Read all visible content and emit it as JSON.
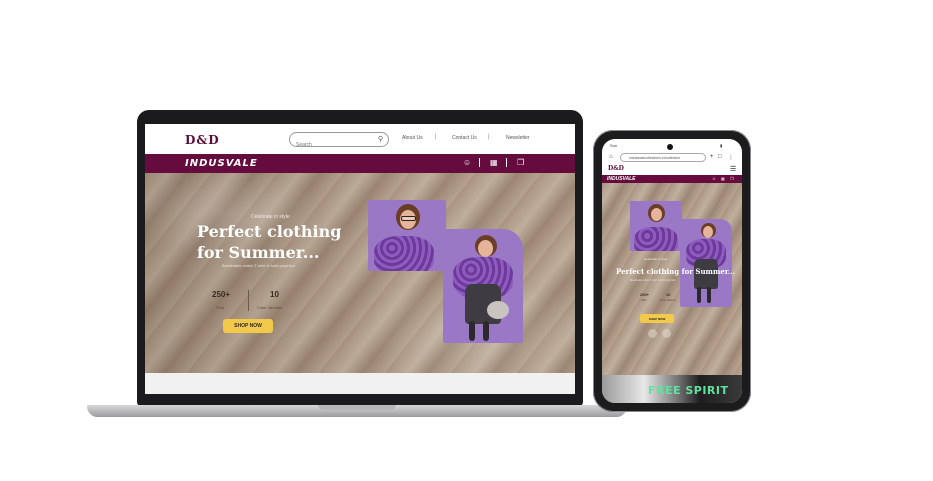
{
  "laptop": {
    "brand_logo": "D&D",
    "search_placeholder": "Search",
    "nav": {
      "about": "About Us",
      "contact": "Contact Us",
      "newsletter": "Newsletter",
      "separator": "|"
    },
    "bar_logo": "INDUSVALE",
    "hero": {
      "kicker": "Celebrate in style",
      "title_line1": "Perfect clothing",
      "title_line2": "for Summer...",
      "subtitle": "Breathable cotton T-shirt in bold graphics",
      "stats": [
        {
          "value": "250+",
          "label": "Sold"
        },
        {
          "value": "10",
          "label": "Color Variants"
        }
      ],
      "cta": "SHOP NOW"
    }
  },
  "phone": {
    "status_time": "Sun",
    "url": "induswalecollections.in/collection",
    "brand_logo": "D&D",
    "bar_logo": "INDUSVALE",
    "hero": {
      "kicker": "Celebrate in style",
      "title": "Perfect clothing for Summer...",
      "subtitle": "Breathable cotton T-shirt in bold graphics",
      "stats": [
        {
          "value": "250+",
          "label": "Sold"
        },
        {
          "value": "10",
          "label": "Color Variants"
        }
      ],
      "cta": "SHOP NOW"
    },
    "banner_text": "FREE SPIRIT"
  },
  "colors": {
    "brand": "#660b3e",
    "cta": "#f3c94b",
    "banner_text": "#5fe3a0"
  },
  "icons": [
    "search-icon",
    "user-icon",
    "bag-icon",
    "copy-icon",
    "menu-icon",
    "home-icon",
    "share-icon"
  ]
}
